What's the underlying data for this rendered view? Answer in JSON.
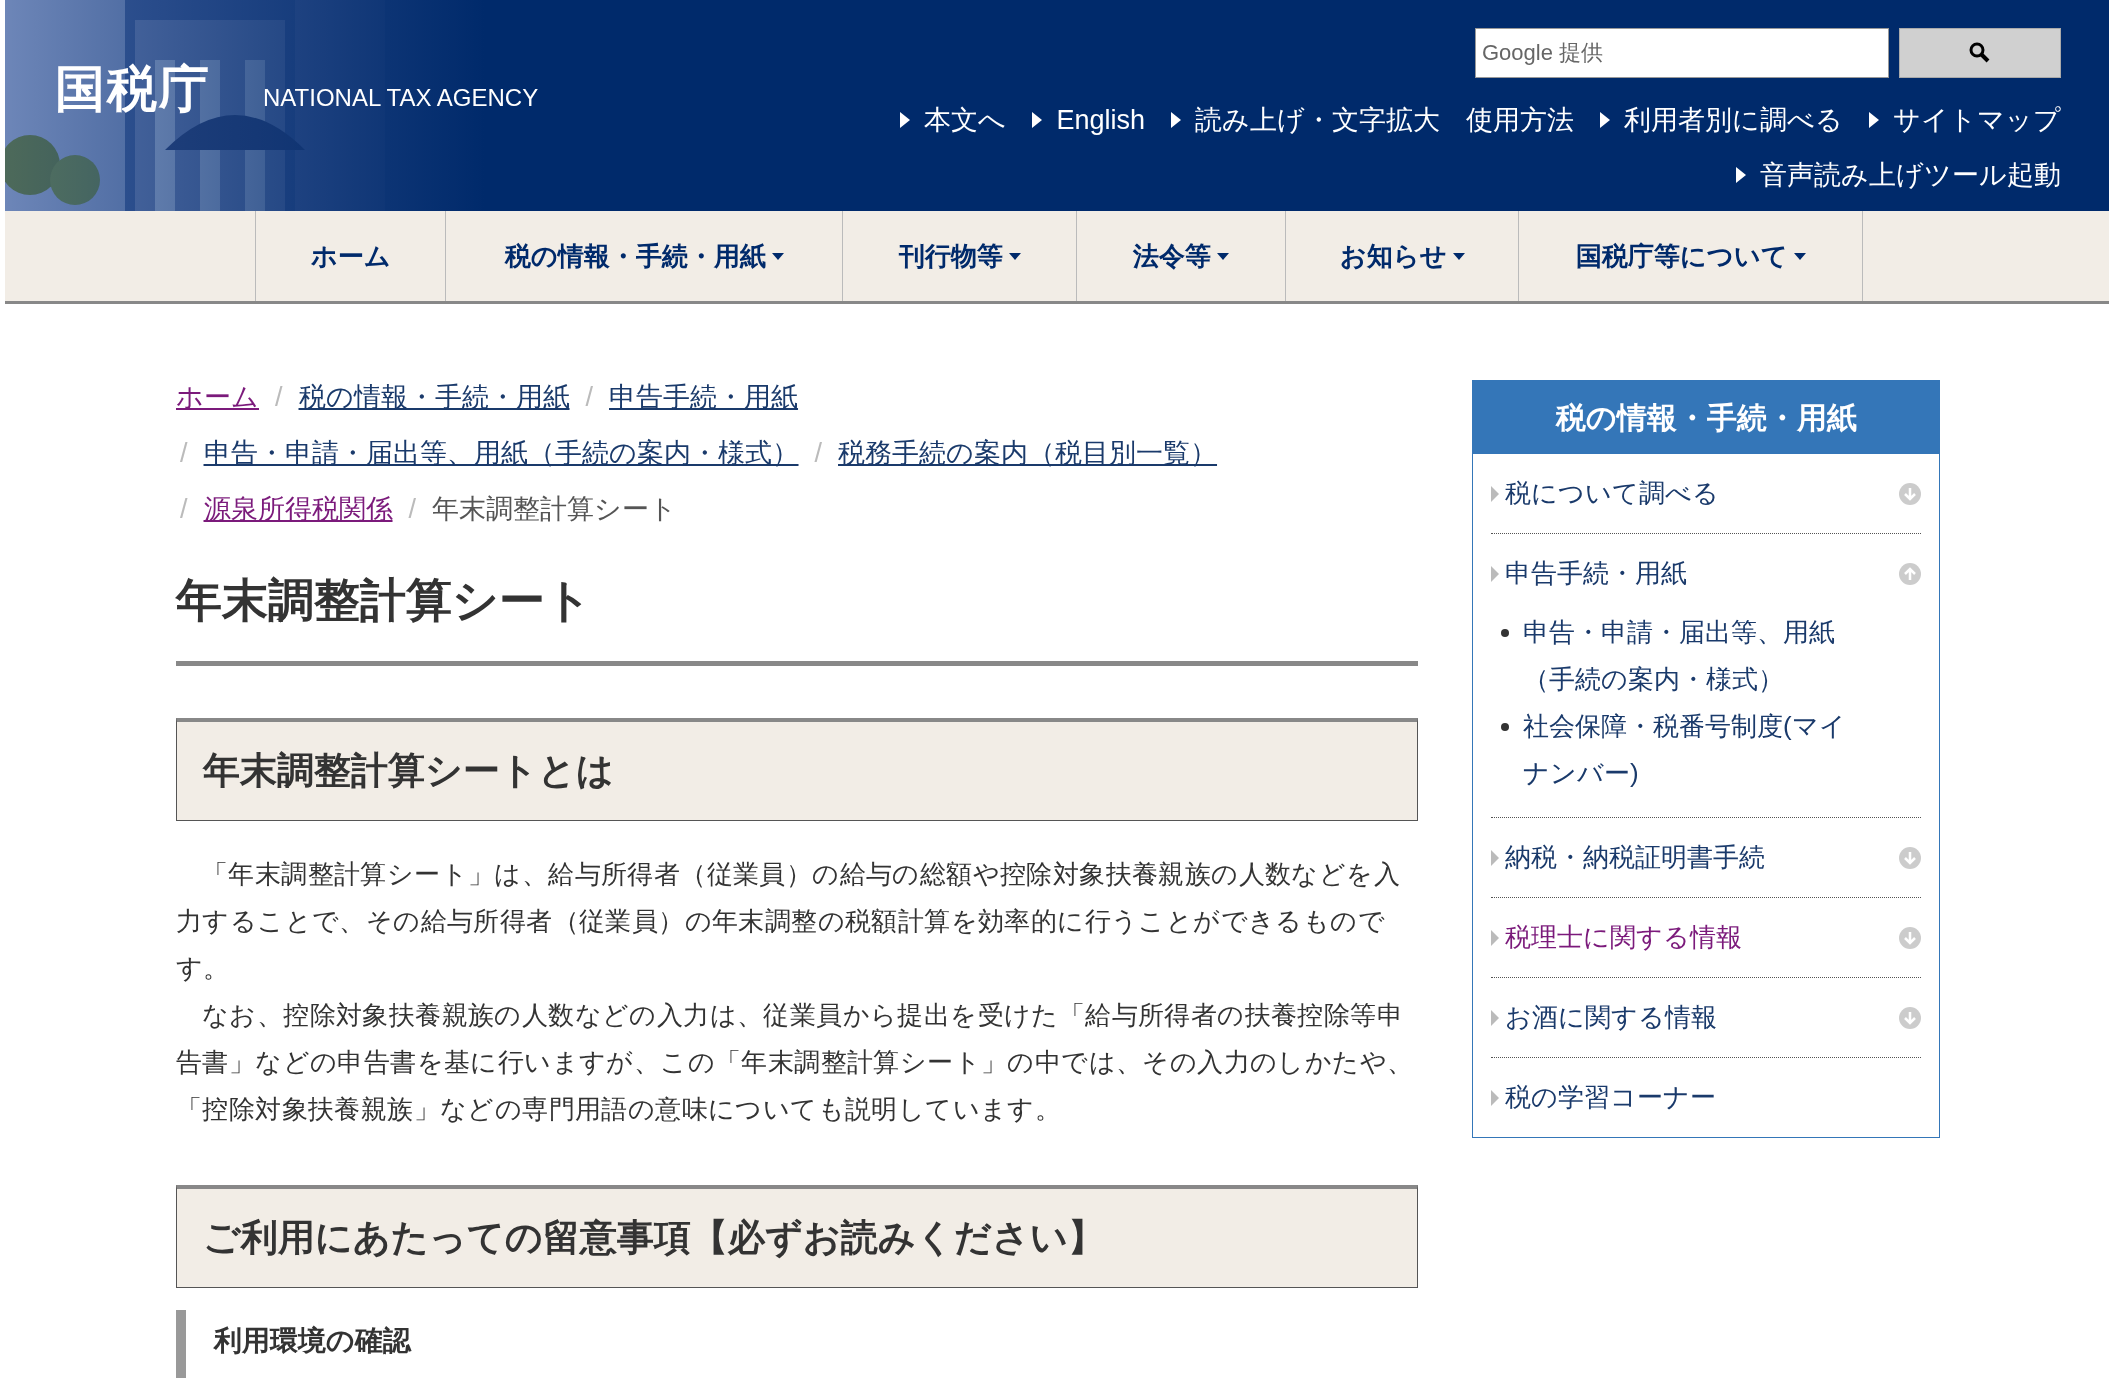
{
  "header": {
    "logo": "国税庁",
    "logo_sub": "NATIONAL TAX AGENCY",
    "search": {
      "placeholder": "Google 提供"
    },
    "links": [
      {
        "label": "本文へ",
        "arrow": true
      },
      {
        "label": "English",
        "arrow": true
      },
      {
        "label": "読み上げ・文字拡大",
        "arrow": true
      },
      {
        "label": "使用方法",
        "arrow": false
      },
      {
        "label": "利用者別に調べる",
        "arrow": true
      },
      {
        "label": "サイトマップ",
        "arrow": true
      }
    ],
    "links_row2": [
      {
        "label": "音声読み上げツール起動",
        "arrow": true
      }
    ]
  },
  "nav": [
    {
      "label": "ホーム",
      "dropdown": false
    },
    {
      "label": "税の情報・手続・用紙",
      "dropdown": true
    },
    {
      "label": "刊行物等",
      "dropdown": true
    },
    {
      "label": "法令等",
      "dropdown": true
    },
    {
      "label": "お知らせ",
      "dropdown": true
    },
    {
      "label": "国税庁等について",
      "dropdown": true
    }
  ],
  "breadcrumb": [
    {
      "items": [
        {
          "label": "ホーム",
          "visited": true,
          "separator": "/"
        },
        {
          "label": "税の情報・手続・用紙",
          "visited": false,
          "separator": "/"
        },
        {
          "label": "申告手続・用紙",
          "visited": false
        }
      ]
    },
    {
      "items": [
        {
          "label": "申告・申請・届出等、用紙（手続の案内・様式）",
          "visited": false,
          "separator_before": "/",
          "separator": "/"
        },
        {
          "label": "税務手続の案内（税目別一覧）",
          "visited": false
        }
      ]
    },
    {
      "items": [
        {
          "label": "源泉所得税関係",
          "visited": true,
          "separator_before": "/",
          "separator": "/"
        }
      ]
    }
  ],
  "breadcrumb_current": "年末調整計算シート",
  "title": "年末調整計算シート",
  "sections": [
    {
      "heading": "年末調整計算シートとは",
      "paragraphs": [
        "「年末調整計算シート」は、給与所得者（従業員）の給与の総額や控除対象扶養親族の人数などを入力することで、その給与所得者（従業員）の年末調整の税額計算を効率的に行うことができるものです。",
        "なお、控除対象扶養親族の人数などの入力は、従業員から提出を受けた「給与所得者の扶養控除等申告書」などの申告書を基に行いますが、この「年末調整計算シート」の中では、その入力のしかたや、「控除対象扶養親族」などの専門用語の意味についても説明しています。"
      ]
    },
    {
      "heading": "ご利用にあたっての留意事項【必ずお読みください】",
      "subheading": "利用環境の確認"
    }
  ],
  "sidebar": {
    "title": "税の情報・手続・用紙",
    "items": [
      {
        "label": "税について調べる",
        "expanded": false,
        "visited": false
      },
      {
        "label": "申告手続・用紙",
        "expanded": true,
        "visited": false,
        "children": [
          {
            "label": "申告・申請・届出等、用紙（手続の案内・様式）"
          },
          {
            "label": "社会保障・税番号制度(マイナンバー)"
          }
        ]
      },
      {
        "label": "納税・納税証明書手続",
        "expanded": false,
        "visited": false
      },
      {
        "label": "税理士に関する情報",
        "expanded": false,
        "visited": true
      },
      {
        "label": "お酒に関する情報",
        "expanded": false,
        "visited": false
      },
      {
        "label": "税の学習コーナー",
        "visited": false
      }
    ]
  }
}
